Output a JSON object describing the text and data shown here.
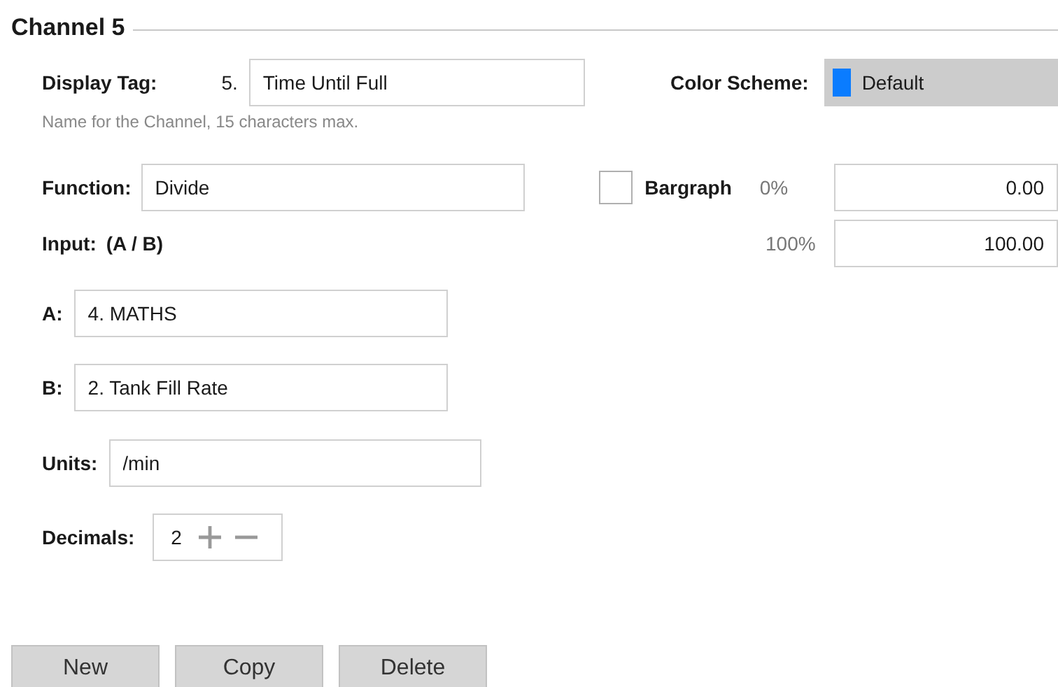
{
  "section": {
    "title": "Channel 5"
  },
  "display_tag": {
    "label": "Display Tag:",
    "prefix": "5.",
    "value": "Time Until Full",
    "hint": "Name for the Channel, 15 characters max."
  },
  "color_scheme": {
    "label": "Color Scheme:",
    "value": "Default",
    "color": "#0a7cff"
  },
  "function": {
    "label": "Function:",
    "value": "Divide"
  },
  "bargraph": {
    "label": "Bargraph",
    "checked": false,
    "min_label": "0%",
    "min_value": "0.00",
    "max_label": "100%",
    "max_value": "100.00"
  },
  "input": {
    "label": "Input:",
    "formula": "(A / B)"
  },
  "operands": [
    {
      "label": "A:",
      "value": "4. MATHS"
    },
    {
      "label": "B:",
      "value": "2. Tank Fill Rate"
    }
  ],
  "units": {
    "label": "Units:",
    "value": "/min"
  },
  "decimals": {
    "label": "Decimals:",
    "value": "2"
  },
  "buttons": [
    "New",
    "Copy",
    "Delete"
  ]
}
